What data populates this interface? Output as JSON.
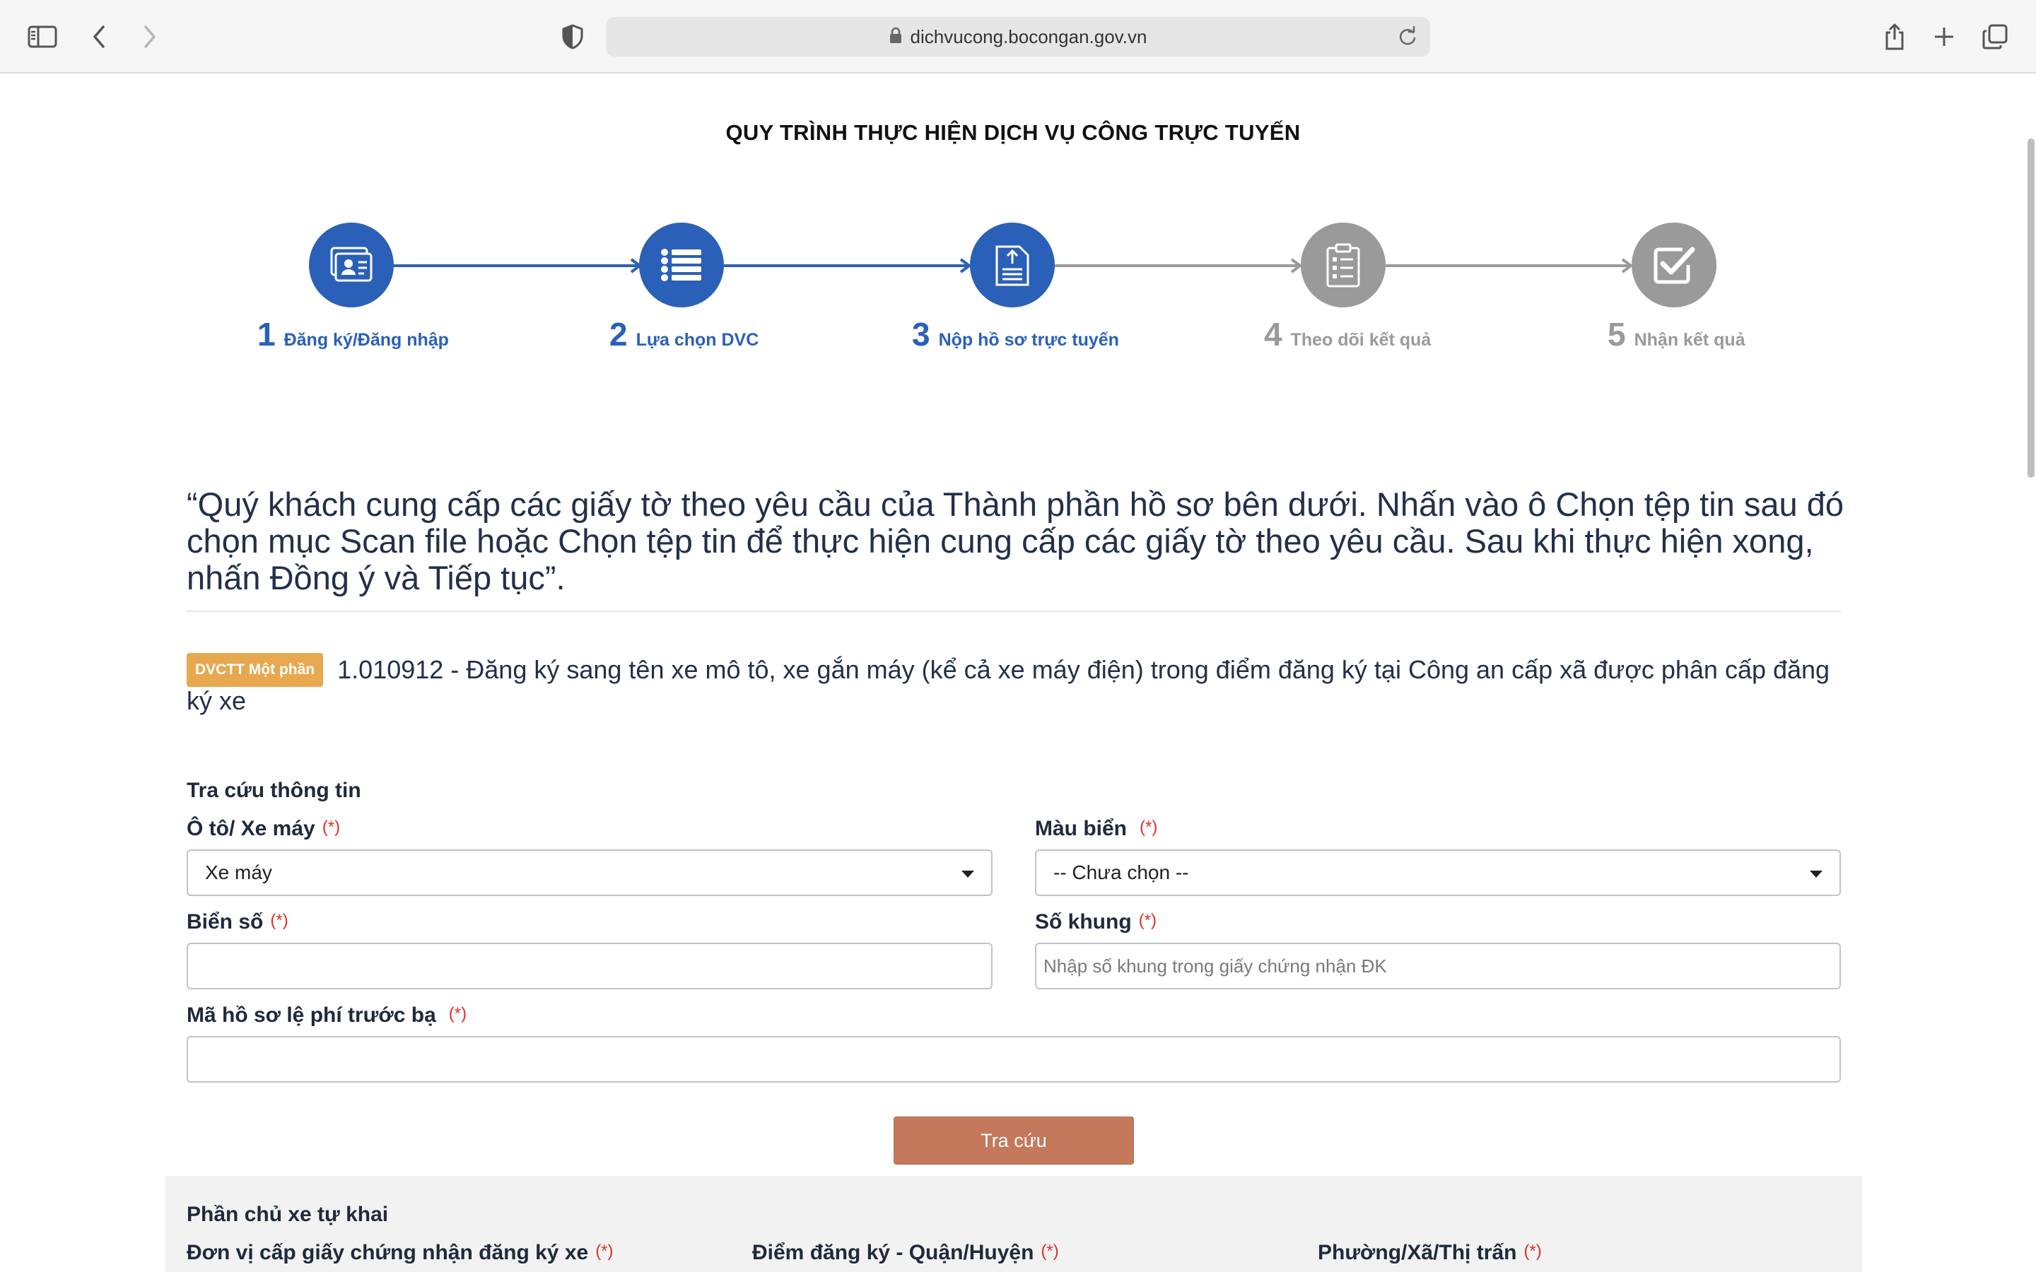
{
  "browser": {
    "url": "dichvucong.bocongan.gov.vn",
    "icons": [
      "sidebar-icon",
      "back-icon",
      "forward-icon",
      "shield-icon",
      "lock-icon",
      "reload-icon",
      "share-icon",
      "new-tab-icon",
      "tabs-icon"
    ]
  },
  "page": {
    "title": "QUY TRÌNH THỰC HIỆN DỊCH VỤ CÔNG TRỰC TUYẾN"
  },
  "steps": [
    {
      "num": "1",
      "label": "Đăng ký/Đăng nhập",
      "icon": "id-card-icon",
      "active": true
    },
    {
      "num": "2",
      "label": "Lựa chọn DVC",
      "icon": "list-icon",
      "active": true
    },
    {
      "num": "3",
      "label": "Nộp hồ sơ trực tuyến",
      "icon": "document-upload-icon",
      "active": true
    },
    {
      "num": "4",
      "label": "Theo dõi kết quả",
      "icon": "clipboard-icon",
      "active": false
    },
    {
      "num": "5",
      "label": "Nhận kết quả",
      "icon": "checkbox-icon",
      "active": false
    }
  ],
  "colors": {
    "active": "#2b60b8",
    "inactive": "#9a9a9a",
    "badge": "#e7a850",
    "button": "#c4795c",
    "required": "#e0312b"
  },
  "instruction": "“Quý khách cung cấp các giấy tờ theo yêu cầu của Thành phần hồ sơ bên dưới. Nhấn vào ô Chọn tệp tin sau đó chọn mục Scan file hoặc Chọn tệp tin để thực hiện cung cấp các giấy tờ theo yêu cầu. Sau khi thực hiện xong, nhấn Đồng ý và Tiếp tục”.",
  "service": {
    "badge": "DVCTT Một phần",
    "text": "1.010912 - Đăng ký sang tên xe mô tô, xe gắn máy (kể cả xe máy điện) trong điểm đăng ký tại Công an cấp xã được phân cấp đăng ký xe"
  },
  "lookup": {
    "section_title": "Tra cứu thông tin",
    "required_mark": "(*)",
    "vehicle_type": {
      "label": "Ô tô/ Xe máy",
      "value": "Xe máy"
    },
    "plate_color": {
      "label": "Màu biển",
      "value": "-- Chưa chọn --"
    },
    "plate_number": {
      "label": "Biển số",
      "value": ""
    },
    "frame_number": {
      "label": "Số khung",
      "placeholder": "Nhập số khung trong giấy chứng nhận ĐK"
    },
    "fee_record": {
      "label": "Mã hồ sơ lệ phí trước bạ",
      "value": ""
    },
    "search_button": "Tra cứu"
  },
  "owner": {
    "section_title": "Phần chủ xe tự khai",
    "issuing_unit_label": "Đơn vị cấp giấy chứng nhận đăng ký xe",
    "district_label": "Điểm đăng ký - Quận/Huyện",
    "ward_label": "Phường/Xã/Thị trấn"
  }
}
